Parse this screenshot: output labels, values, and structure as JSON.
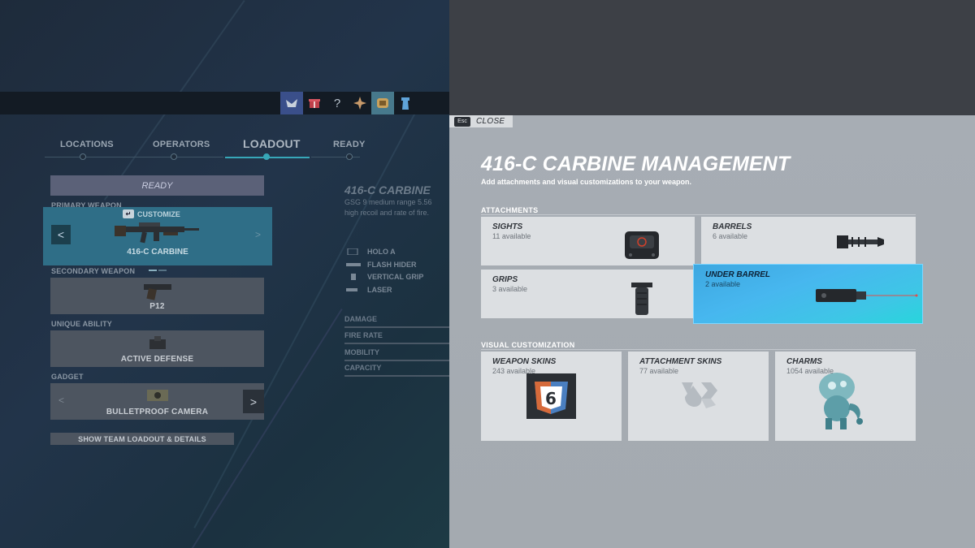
{
  "topbar": {
    "icons": [
      "operator-eagle-icon",
      "gift-icon",
      "help-icon",
      "compass-icon",
      "badge-icon",
      "tower-icon"
    ],
    "help_glyph": "?"
  },
  "tabs": {
    "locations": "LOCATIONS",
    "operators": "OPERATORS",
    "loadout": "LOADOUT",
    "ready": "READY"
  },
  "ready_button": "READY",
  "loadout": {
    "primary_label": "PRIMARY WEAPON",
    "customize_label": "CUSTOMIZE",
    "customize_key": "↵",
    "primary_name": "416-C CARBINE",
    "secondary_label": "SECONDARY WEAPON",
    "secondary_name": "P12",
    "ability_label": "UNIQUE ABILITY",
    "ability_name": "ACTIVE DEFENSE",
    "gadget_label": "GADGET",
    "gadget_name": "BULLETPROOF CAMERA",
    "show_team": "SHOW TEAM LOADOUT & DETAILS",
    "arrow_left": "<",
    "arrow_right": ">"
  },
  "weapon_info": {
    "title": "416-C CARBINE",
    "desc_line1": "GSG 9 medium range 5.56",
    "desc_line2": "high recoil and rate of fire.",
    "attachments": [
      "HOLO A",
      "FLASH HIDER",
      "VERTICAL GRIP",
      "LASER"
    ],
    "stats": [
      "DAMAGE",
      "FIRE RATE",
      "MOBILITY",
      "CAPACITY"
    ]
  },
  "close": {
    "key": "Esc",
    "label": "CLOSE"
  },
  "management": {
    "title": "416-C CARBINE MANAGEMENT",
    "subtitle": "Add attachments and visual customizations to your weapon.",
    "attachments_label": "ATTACHMENTS",
    "visual_label": "VISUAL CUSTOMIZATION",
    "cards": {
      "sights": {
        "title": "SIGHTS",
        "sub": "11 available"
      },
      "barrels": {
        "title": "BARRELS",
        "sub": "6 available"
      },
      "grips": {
        "title": "GRIPS",
        "sub": "3 available"
      },
      "under_barrel": {
        "title": "UNDER BARREL",
        "sub": "2 available"
      },
      "weapon_skins": {
        "title": "WEAPON SKINS",
        "sub": "243 available"
      },
      "attachment_skins": {
        "title": "ATTACHMENT SKINS",
        "sub": "77 available"
      },
      "charms": {
        "title": "CHARMS",
        "sub": "1054 available"
      }
    },
    "accent_color": "#3ec6e6"
  }
}
